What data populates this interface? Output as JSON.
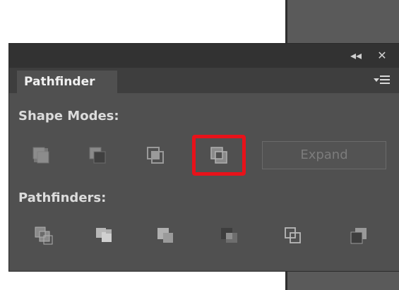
{
  "panel": {
    "title_buttons": {
      "collapse": "◂◂",
      "close": "✕"
    },
    "tab_label": "Pathfinder",
    "menu_icon": "panel-menu-icon",
    "shape_modes": {
      "label": "Shape Modes:",
      "buttons": [
        {
          "name": "unite",
          "icon": "unite-icon"
        },
        {
          "name": "minus-front",
          "icon": "minus-front-icon"
        },
        {
          "name": "intersect",
          "icon": "intersect-icon"
        },
        {
          "name": "exclude",
          "icon": "exclude-icon",
          "highlighted": true
        }
      ],
      "expand_label": "Expand"
    },
    "pathfinders": {
      "label": "Pathfinders:",
      "buttons": [
        {
          "name": "divide",
          "icon": "divide-icon"
        },
        {
          "name": "trim",
          "icon": "trim-icon"
        },
        {
          "name": "merge",
          "icon": "merge-icon"
        },
        {
          "name": "crop",
          "icon": "crop-icon"
        },
        {
          "name": "outline",
          "icon": "outline-icon"
        },
        {
          "name": "minus-back",
          "icon": "minus-back-icon"
        }
      ]
    }
  },
  "colors": {
    "panel_bg": "#505050",
    "highlight": "#e8121a"
  }
}
